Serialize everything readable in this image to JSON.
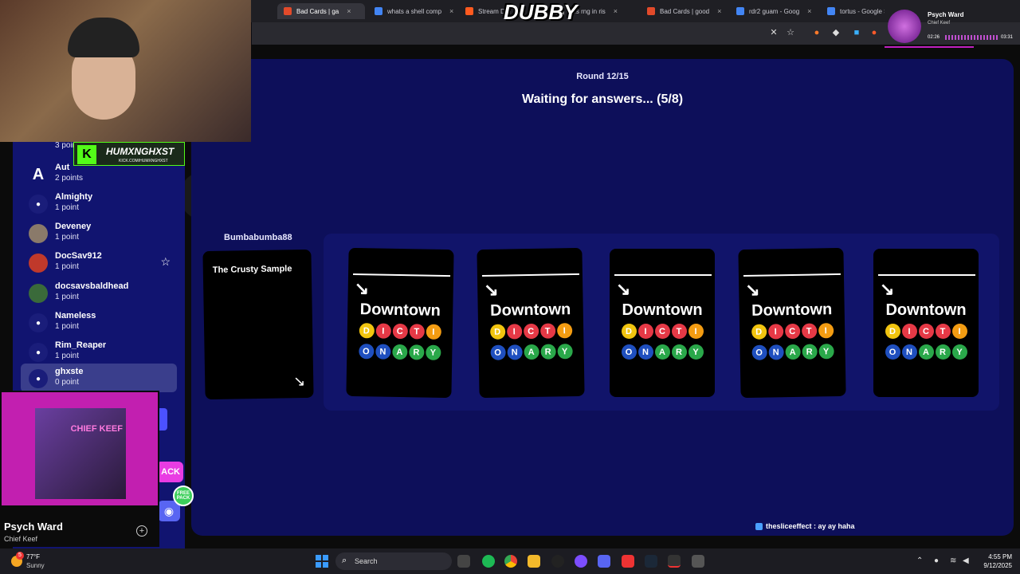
{
  "browser": {
    "tabs": [
      {
        "label": "Bad Cards | ga",
        "active": true,
        "color": "#e24a2a"
      },
      {
        "label": "whats a shell comp",
        "active": false,
        "color": "#4285f4"
      },
      {
        "label": "Stream Dre",
        "active": false,
        "color": "#ff5a1f"
      },
      {
        "label": "rles rng in ris",
        "active": false,
        "color": "#888888"
      },
      {
        "label": "Bad Cards | good",
        "active": false,
        "color": "#e24a2a"
      },
      {
        "label": "rdr2 guam - Goog",
        "active": false,
        "color": "#4285f4"
      },
      {
        "label": "tortus - Google Se",
        "active": false,
        "color": "#4285f4"
      }
    ]
  },
  "overlay": {
    "streamer_name": "DUBBY",
    "kick_name": "HUMXNGHXST",
    "kick_url": "KICK.COM/HUMXNGHXST",
    "kick_letter": "K"
  },
  "game": {
    "round": "Round 12/15",
    "status": "Waiting for answers... (5/8)",
    "czar_name": "Bumbabumba88",
    "prompt_text": "The Crusty Sample",
    "card_brand": "Downtown",
    "card_letters_row1": [
      "D",
      "I",
      "C",
      "T",
      "I"
    ],
    "card_letters_row2": [
      "O",
      "N",
      "A",
      "R",
      "Y"
    ],
    "card_colors_row1": [
      "#f1c40f",
      "#e63946",
      "#e63946",
      "#e63946",
      "#f39c12"
    ],
    "card_colors_row2": [
      "#1f4fbf",
      "#1f4fbf",
      "#2aa84a",
      "#2aa84a",
      "#2aa84a"
    ],
    "answer_card_count": 5
  },
  "players": [
    {
      "name": "",
      "points": "3 points",
      "avatar": "person"
    },
    {
      "name": "Aut",
      "points": "2 points",
      "avatar": "A"
    },
    {
      "name": "Almighty",
      "points": "1 point",
      "avatar": "person"
    },
    {
      "name": "Deveney",
      "points": "1 point",
      "avatar": "img"
    },
    {
      "name": "DocSav912",
      "points": "1 point",
      "avatar": "img",
      "starred": true
    },
    {
      "name": "docsavsbaldhead",
      "points": "1 point",
      "avatar": "img"
    },
    {
      "name": "Nameless",
      "points": "1 point",
      "avatar": "person"
    },
    {
      "name": "Rim_Reaper",
      "points": "1 point",
      "avatar": "person"
    },
    {
      "name": "ghxste",
      "points": "0 point",
      "avatar": "person",
      "me": true
    }
  ],
  "sidebar_buttons": {
    "pack_label": "ACK",
    "free_pack": "FREE PACK"
  },
  "now_playing": {
    "title": "Psych Ward",
    "artist": "Chief Keef",
    "art_text": "CHIEF KEEF",
    "top_title": "Psych Ward",
    "top_artist": "Chief Keef",
    "time_elapsed": "02:26",
    "time_total": "03:31"
  },
  "chat": {
    "message": "thesliceeffect : ay ay haha"
  },
  "taskbar": {
    "temp": "77°F",
    "condition": "Sunny",
    "weather_badge": "5",
    "search_placeholder": "Search",
    "time": "4:55 PM",
    "date": "9/12/2025"
  },
  "colors": {
    "game_bg": "#0d0f5a",
    "sidebar_bg": "#111470",
    "accent_pink": "#e93ce3",
    "kick_green": "#53fc18"
  }
}
